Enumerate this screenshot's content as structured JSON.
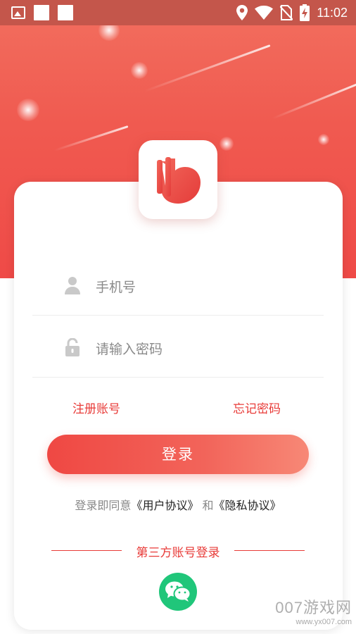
{
  "status_bar": {
    "time": "11:02"
  },
  "login": {
    "phone_placeholder": "手机号",
    "password_placeholder": "请输入密码",
    "register_link": "注册账号",
    "forgot_link": "忘记密码",
    "login_button": "登录"
  },
  "agreement": {
    "prefix": "登录即同意",
    "user_agreement": "《用户协议》",
    "and": " 和",
    "privacy_policy": "《隐私协议》"
  },
  "third_party": {
    "title": "第三方账号登录",
    "wechat_icon": "wechat-icon"
  },
  "watermark": {
    "brand": "007游戏网",
    "url": "www.yx007.com"
  },
  "colors": {
    "accent": "#ef4a47",
    "wechat": "#20c67a"
  }
}
